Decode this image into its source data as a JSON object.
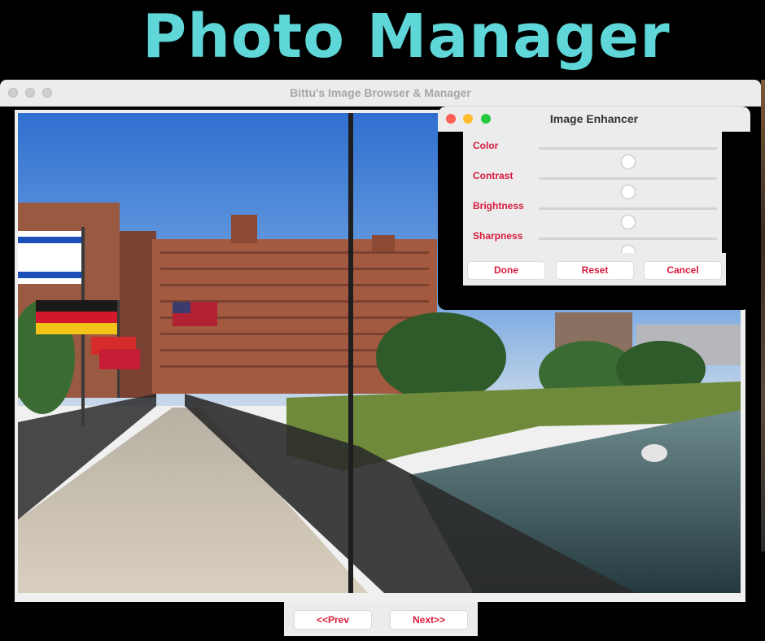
{
  "banner": {
    "title": "Photo Manager",
    "title_color": "#5fd6d8"
  },
  "main_window": {
    "title": "Bittu's Image Browser & Manager",
    "prev_label": "<<Prev",
    "next_label": "Next>>"
  },
  "enhancer": {
    "title": "Image Enhancer",
    "sliders": [
      {
        "label": "Color",
        "value": 0.5
      },
      {
        "label": "Contrast",
        "value": 0.5
      },
      {
        "label": "Brightness",
        "value": 0.5
      },
      {
        "label": "Sharpness",
        "value": 0.5
      }
    ],
    "buttons": {
      "done": "Done",
      "reset": "Reset",
      "cancel": "Cancel"
    }
  },
  "colors": {
    "accent_text": "#d81b3c",
    "close": "#fe5f57",
    "minimize": "#febc2e",
    "zoom": "#28c840"
  }
}
